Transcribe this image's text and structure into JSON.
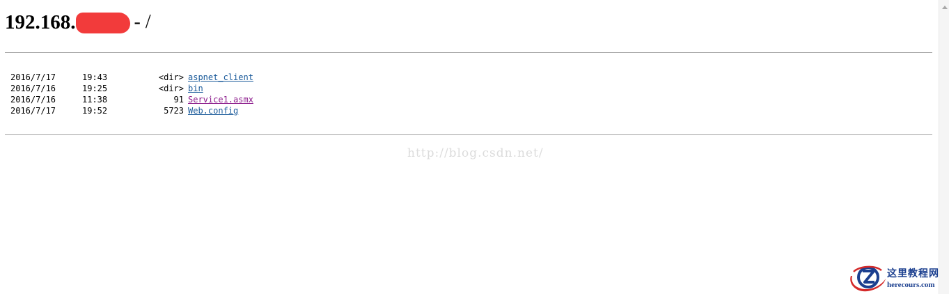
{
  "header": {
    "title_prefix": "192.168.",
    "title_suffix": "- /"
  },
  "listing": {
    "entries": [
      {
        "date": "2016/7/17",
        "time": "19:43",
        "size": "<dir>",
        "name": "aspnet_client",
        "visited": false
      },
      {
        "date": "2016/7/16",
        "time": "19:25",
        "size": "<dir>",
        "name": "bin",
        "visited": false
      },
      {
        "date": "2016/7/16",
        "time": "11:38",
        "size": "91",
        "name": "Service1.asmx",
        "visited": true
      },
      {
        "date": "2016/7/17",
        "time": "19:52",
        "size": "5723",
        "name": "Web.config",
        "visited": false
      }
    ]
  },
  "watermark": {
    "text": "http://blog.csdn.net/"
  },
  "logo": {
    "chinese_text": "这里教程网",
    "url_text": "herecours.com",
    "icon": "z-swoosh-logo-icon"
  },
  "colors": {
    "link": "#1a5a9a",
    "link_visited": "#8b1a8b",
    "redaction": "#f23b3b",
    "logo_blue": "#1b3f8f",
    "logo_red": "#d42a2a"
  }
}
